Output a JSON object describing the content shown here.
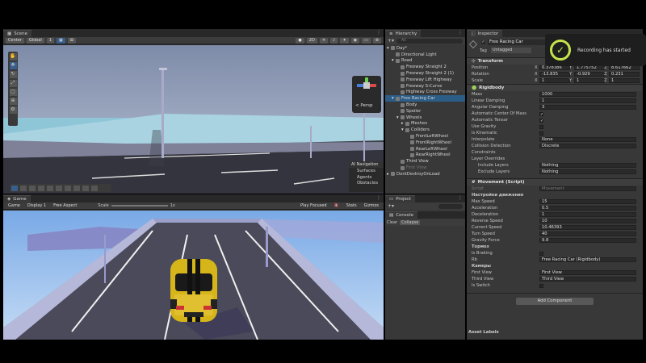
{
  "scene": {
    "tab_label": "Scene",
    "pivot_mode": "Center",
    "space_mode": "Global",
    "grid_value": "1",
    "gizmo_view_label": "< Persp",
    "overlay": {
      "title": "AI Navigation",
      "items": [
        "Surfaces",
        "Agents",
        "Obstacles"
      ]
    }
  },
  "game": {
    "tab_label": "Game",
    "mode": "Game",
    "display": "Display 1",
    "aspect": "Free Aspect",
    "scale_label": "Scale",
    "scale_value": "1x",
    "play_mode": "Play Focused",
    "stats_label": "Stats",
    "gizmos_label": "Gizmos"
  },
  "hierarchy": {
    "tab_label": "Hierarchy",
    "search_placeholder": "All",
    "rows": [
      {
        "label": "Day*",
        "depth": 0,
        "selected": false,
        "dim": false,
        "arrow": "▾",
        "icon": "scene-icon"
      },
      {
        "label": "Directional Light",
        "depth": 1,
        "selected": false,
        "dim": false,
        "arrow": "",
        "icon": "light-icon"
      },
      {
        "label": "Road",
        "depth": 1,
        "selected": false,
        "dim": false,
        "arrow": "▾",
        "icon": "cube-icon"
      },
      {
        "label": "Freeway Straight 2",
        "depth": 2,
        "selected": false,
        "dim": false,
        "arrow": "",
        "icon": "cube-icon"
      },
      {
        "label": "Freeway Straight 2 (1)",
        "depth": 2,
        "selected": false,
        "dim": false,
        "arrow": "",
        "icon": "cube-icon"
      },
      {
        "label": "Freeway Lift Highway",
        "depth": 2,
        "selected": false,
        "dim": false,
        "arrow": "",
        "icon": "cube-icon"
      },
      {
        "label": "Freeway S-Curve",
        "depth": 2,
        "selected": false,
        "dim": false,
        "arrow": "",
        "icon": "cube-icon"
      },
      {
        "label": "Highway Cross Freeway",
        "depth": 2,
        "selected": false,
        "dim": false,
        "arrow": "",
        "icon": "cube-icon"
      },
      {
        "label": "Free Racing Car",
        "depth": 1,
        "selected": true,
        "dim": false,
        "arrow": "▾",
        "icon": "cube-icon"
      },
      {
        "label": "Body",
        "depth": 2,
        "selected": false,
        "dim": false,
        "arrow": "",
        "icon": "cube-icon"
      },
      {
        "label": "Spoiler",
        "depth": 2,
        "selected": false,
        "dim": false,
        "arrow": "",
        "icon": "cube-icon"
      },
      {
        "label": "Wheels",
        "depth": 2,
        "selected": false,
        "dim": false,
        "arrow": "▾",
        "icon": "cube-icon"
      },
      {
        "label": "Meshes",
        "depth": 3,
        "selected": false,
        "dim": false,
        "arrow": "▸",
        "icon": "cube-icon"
      },
      {
        "label": "Colliders",
        "depth": 3,
        "selected": false,
        "dim": false,
        "arrow": "▾",
        "icon": "cube-icon"
      },
      {
        "label": "FrontLeftWheel",
        "depth": 4,
        "selected": false,
        "dim": false,
        "arrow": "",
        "icon": "cube-icon"
      },
      {
        "label": "FrontRightWheel",
        "depth": 4,
        "selected": false,
        "dim": false,
        "arrow": "",
        "icon": "cube-icon"
      },
      {
        "label": "RearLeftWheel",
        "depth": 4,
        "selected": false,
        "dim": false,
        "arrow": "",
        "icon": "cube-icon"
      },
      {
        "label": "RearRightWheel",
        "depth": 4,
        "selected": false,
        "dim": false,
        "arrow": "",
        "icon": "cube-icon"
      },
      {
        "label": "Third View",
        "depth": 2,
        "selected": false,
        "dim": false,
        "arrow": "",
        "icon": "cube-icon"
      },
      {
        "label": "First View",
        "depth": 2,
        "selected": false,
        "dim": true,
        "arrow": "",
        "icon": "cube-icon"
      },
      {
        "label": "DontDestroyOnLoad",
        "depth": 0,
        "selected": false,
        "dim": false,
        "arrow": "▸",
        "icon": "scene-icon"
      }
    ]
  },
  "project": {
    "tab_label": "Project"
  },
  "console": {
    "tab_label": "Console",
    "clear_label": "Clear",
    "collapse_label": "Collapse",
    "counts": [
      "0",
      "0",
      "0"
    ]
  },
  "inspector": {
    "tab_label": "Inspector",
    "object_name": "Free Racing Car",
    "tag_label": "Tag",
    "tag_value": "Untagged",
    "transform": {
      "title": "Transform",
      "rows": [
        {
          "label": "Position",
          "x": "0.378386",
          "y": "1.775752",
          "z": "8.617662"
        },
        {
          "label": "Rotation",
          "x": "-13.835",
          "y": "-0.929",
          "z": "0.231"
        },
        {
          "label": "Scale",
          "x": "1",
          "y": "1",
          "z": "1"
        }
      ]
    },
    "rigidbody": {
      "title": "Rigidbody",
      "fields": [
        {
          "label": "Mass",
          "value": "1000",
          "type": "text"
        },
        {
          "label": "Linear Damping",
          "value": "1",
          "type": "text"
        },
        {
          "label": "Angular Damping",
          "value": "3",
          "type": "text"
        },
        {
          "label": "Automatic Center Of Mass",
          "value": "✓",
          "type": "check"
        },
        {
          "label": "Automatic Tensor",
          "value": "✓",
          "type": "check"
        },
        {
          "label": "Use Gravity",
          "value": "",
          "type": "check"
        },
        {
          "label": "Is Kinematic",
          "value": "",
          "type": "check"
        },
        {
          "label": "Interpolate",
          "value": "None",
          "type": "text"
        },
        {
          "label": "Collision Detection",
          "value": "Discrete",
          "type": "text"
        }
      ],
      "constraints_label": "Constraints",
      "layer_overrides_label": "Layer Overrides",
      "include_label": "Include Layers",
      "include_value": "Nothing",
      "exclude_label": "Exclude Layers",
      "exclude_value": "Nothing"
    },
    "movement": {
      "title": "Movement (Script)",
      "script_label": "Script",
      "script_value": "Movement",
      "section1": "Настройки движения",
      "fields": [
        {
          "label": "Max Speed",
          "value": "15"
        },
        {
          "label": "Acceleration",
          "value": "0.5"
        },
        {
          "label": "Deceleration",
          "value": "1"
        },
        {
          "label": "Reverse Speed",
          "value": "10"
        },
        {
          "label": "Current Speed",
          "value": "10.46393"
        },
        {
          "label": "Turn Speed",
          "value": "40"
        },
        {
          "label": "Gravity Force",
          "value": "9.8"
        }
      ],
      "section2": "Тормоз",
      "braking_label": "Is Braking",
      "rb_label": "Rb",
      "rb_value": "Free Racing Car (Rigidbody)",
      "section3": "Камеры",
      "first_view_label": "First View",
      "first_view_value": "First View",
      "third_view_label": "Third View",
      "third_view_value": "Third View",
      "is_switch_label": "Is Switch"
    },
    "add_component_label": "Add Component",
    "asset_labels": "Asset Labels"
  },
  "notification": {
    "text": "Recording has started"
  }
}
